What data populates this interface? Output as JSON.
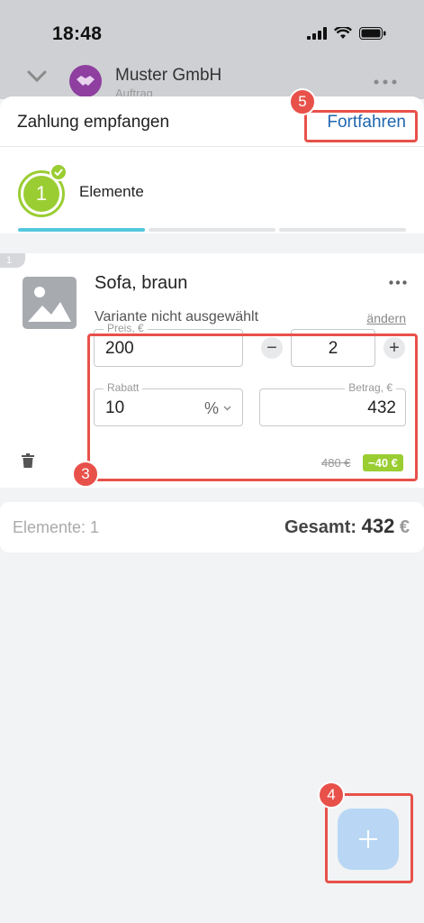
{
  "status": {
    "time": "18:48"
  },
  "background": {
    "company": "Muster GmbH",
    "subtitle": "Auftrag"
  },
  "sheet": {
    "title": "Zahlung empfangen",
    "continue_label": "Fortfahren"
  },
  "steps": [
    {
      "number": "1",
      "label": "Elemente",
      "completed": true
    }
  ],
  "item": {
    "index": "1",
    "name": "Sofa, braun",
    "variant": "Variante nicht ausgewählt",
    "change_label": "ändern",
    "price_label": "Preis, €",
    "price_value": "200",
    "quantity": "2",
    "discount_label": "Rabatt",
    "discount_value": "10",
    "discount_unit": "%",
    "amount_label": "Betrag, €",
    "amount_value": "432",
    "old_price": "480 €",
    "discount_badge": "−40 €"
  },
  "summary": {
    "count_label": "Elemente: 1",
    "total_label": "Gesamt:",
    "total_value": "432",
    "currency": "€"
  },
  "markers": {
    "m3": "3",
    "m4": "4",
    "m5": "5"
  },
  "colors": {
    "accent": "#9acd32",
    "link": "#2066b0",
    "highlight": "#e8514a",
    "progress": "#55c7dd",
    "fab": "#b9d7f5"
  }
}
